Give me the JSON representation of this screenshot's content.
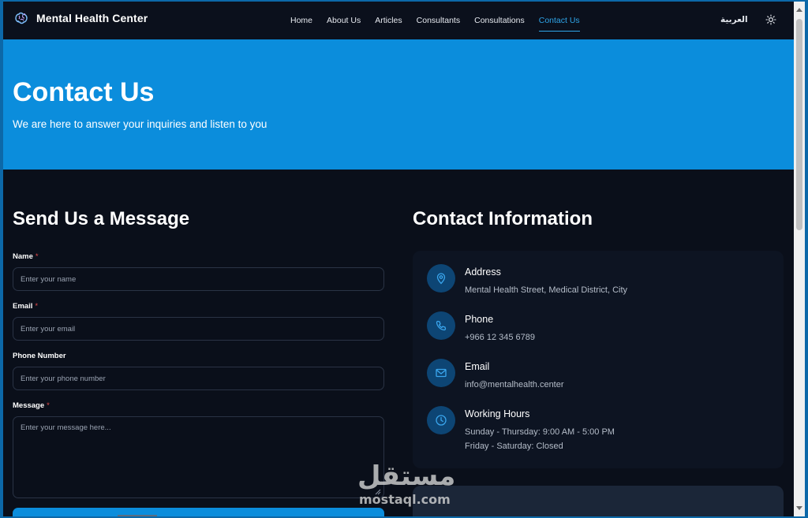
{
  "brand": {
    "name": "Mental Health Center",
    "logo_icon": "brain-logo-icon"
  },
  "nav": {
    "links": [
      {
        "label": "Home",
        "active": false
      },
      {
        "label": "About Us",
        "active": false
      },
      {
        "label": "Articles",
        "active": false
      },
      {
        "label": "Consultants",
        "active": false
      },
      {
        "label": "Consultations",
        "active": false
      },
      {
        "label": "Contact Us",
        "active": true
      }
    ],
    "language": "العربية",
    "theme_icon": "sun-icon"
  },
  "hero": {
    "title": "Contact Us",
    "subtitle": "We are here to answer your inquiries and listen to you"
  },
  "form": {
    "title": "Send Us a Message",
    "fields": {
      "name": {
        "label": "Name",
        "required": "*",
        "placeholder": "Enter your name"
      },
      "email": {
        "label": "Email",
        "required": "*",
        "placeholder": "Enter your email"
      },
      "phone": {
        "label": "Phone Number",
        "placeholder": "Enter your phone number"
      },
      "message": {
        "label": "Message",
        "required": "*",
        "placeholder": "Enter your message here..."
      }
    }
  },
  "contact_info": {
    "title": "Contact Information",
    "items": [
      {
        "icon": "location-pin-icon",
        "title": "Address",
        "lines": [
          "Mental Health Street, Medical District, City"
        ]
      },
      {
        "icon": "phone-icon",
        "title": "Phone",
        "lines": [
          "+966 12 345 6789"
        ]
      },
      {
        "icon": "mail-icon",
        "title": "Email",
        "lines": [
          "info@mentalhealth.center"
        ]
      },
      {
        "icon": "clock-icon",
        "title": "Working Hours",
        "lines": [
          "Sunday - Thursday: 9:00 AM - 5:00 PM",
          "Friday - Saturday: Closed"
        ]
      }
    ]
  },
  "watermark": {
    "arabic": "مستقل",
    "latin": "mostaql.com"
  },
  "colors": {
    "accent": "#0b8ddc",
    "active_link": "#2fa4e7",
    "background": "#0a0f1a",
    "required": "#e44b4b",
    "icon_circle": "#0d4574"
  }
}
